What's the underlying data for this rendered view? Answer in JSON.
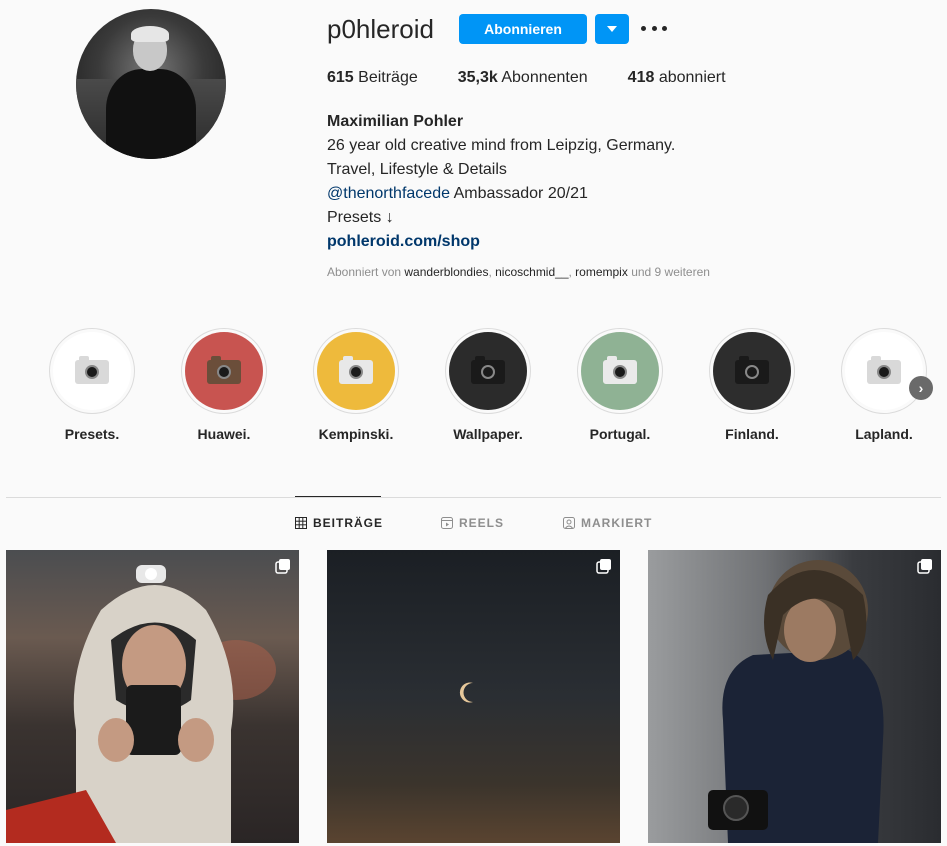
{
  "profile": {
    "username": "p0hleroid",
    "follow_label": "Abonnieren",
    "stats": [
      {
        "value": "615",
        "label": " Beiträge"
      },
      {
        "value": "35,3k",
        "label": " Abonnenten"
      },
      {
        "value": "418",
        "label": " abonniert"
      }
    ],
    "full_name": "Maximilian Pohler",
    "bio_lines": [
      "26 year old creative mind from Leipzig, Germany.",
      "Travel, Lifestyle & Details"
    ],
    "mention": "@thenorthfacede",
    "mention_suffix": " Ambassador 20/21",
    "presets_line": "Presets ↓",
    "website": "pohleroid.com/shop",
    "followed_by": {
      "prefix": "Abonniert von ",
      "users": [
        "wanderblondies",
        "nicoschmid__",
        "romempix"
      ],
      "suffix": " und 9 weiteren"
    }
  },
  "highlights": [
    {
      "label": "Presets.",
      "bg": "#ffffff",
      "cam": "#d9d9d9"
    },
    {
      "label": "Huawei.",
      "bg": "#c85450",
      "cam": "#6b4e3a"
    },
    {
      "label": "Kempinski.",
      "bg": "#eeba3c",
      "cam": "#e8e8e8"
    },
    {
      "label": "Wallpaper.",
      "bg": "#2b2b2b",
      "cam": "#1a1a1a"
    },
    {
      "label": "Portugal.",
      "bg": "#8fb294",
      "cam": "#eaeaea"
    },
    {
      "label": "Finland.",
      "bg": "#2d2d2d",
      "cam": "#1a1a1a"
    },
    {
      "label": "Lapland.",
      "bg": "#ffffff",
      "cam": "#d9d9d9"
    }
  ],
  "tabs": [
    {
      "label": "BEITRÄGE",
      "icon": "grid-icon",
      "active": true
    },
    {
      "label": "REELS",
      "icon": "reels-icon",
      "active": false
    },
    {
      "label": "MARKIERT",
      "icon": "tagged-icon",
      "active": false
    }
  ],
  "colors": {
    "accent": "#0095f6",
    "link": "#00376b"
  }
}
